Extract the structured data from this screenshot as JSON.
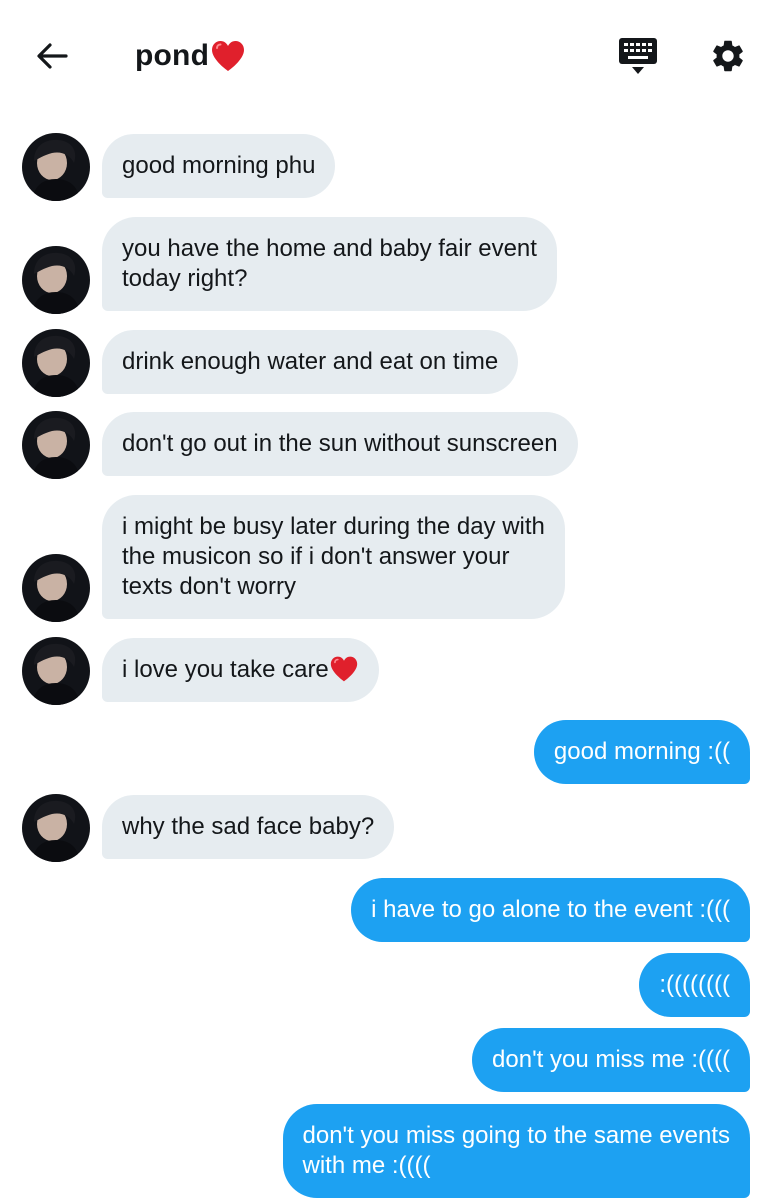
{
  "header": {
    "title": "pond",
    "title_emoji": "heart-emoji",
    "back_icon": "arrow-left-icon",
    "keyboard_icon": "keyboard-icon",
    "settings_icon": "gear-icon"
  },
  "colors": {
    "incoming_bubble": "#e6ecf0",
    "outgoing_bubble": "#1da1f2",
    "outgoing_text": "#ffffff",
    "text": "#14171a"
  },
  "messages": [
    {
      "dir": "in",
      "text": "good morning phu"
    },
    {
      "dir": "in",
      "text": "you have the home and baby fair event\ntoday right?"
    },
    {
      "dir": "in",
      "text": "drink enough water and eat on time"
    },
    {
      "dir": "in",
      "text": "don't go out in the sun without sunscreen"
    },
    {
      "dir": "in",
      "text": "i might be busy later during the day with\nthe musicon so if i don't answer your\ntexts don't worry"
    },
    {
      "dir": "in",
      "text": "i love you take care",
      "emoji": "heart-emoji"
    },
    {
      "dir": "out",
      "text": "good morning :(("
    },
    {
      "dir": "in",
      "text": "why the sad face baby?"
    },
    {
      "dir": "out",
      "text": "i have to go alone to the event :((("
    },
    {
      "dir": "out",
      "text": ":(((((((("
    },
    {
      "dir": "out",
      "text": "don't you miss me :(((("
    },
    {
      "dir": "out",
      "text": "don't you miss going to the same events\nwith me :(((("
    }
  ]
}
